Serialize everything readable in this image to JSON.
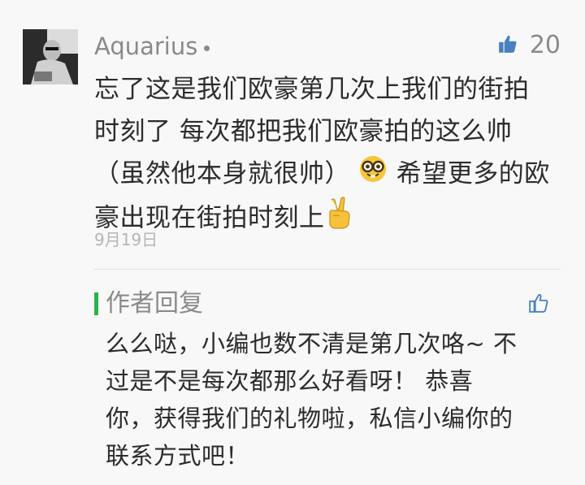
{
  "comment": {
    "username": "Aquarius",
    "likes": "20",
    "lines": [
      "忘了这是我们欧豪第几次上我们的街拍",
      "时刻了 每次都把我们欧豪拍的这么帅",
      "（虽然他本身就很帅）",
      "希望更多的欧",
      "豪出现在街拍时刻上"
    ],
    "date": "9月19日"
  },
  "reply": {
    "title": "作者回复",
    "lines": [
      "么么哒，小编也数不清是第几次咯~ 不",
      "过是不是每次都那么好看呀！ 恭喜",
      "你，获得我们的礼物啦，私信小编你的",
      "联系方式吧！"
    ]
  },
  "colors": {
    "accent_green": "#29b34a",
    "like_blue": "#4a7fc1",
    "meta_gray": "#8a8a8a"
  },
  "icons": {
    "like": "thumbs-up-icon",
    "nerd": "nerd-face-emoji",
    "victory": "victory-hand-emoji"
  }
}
